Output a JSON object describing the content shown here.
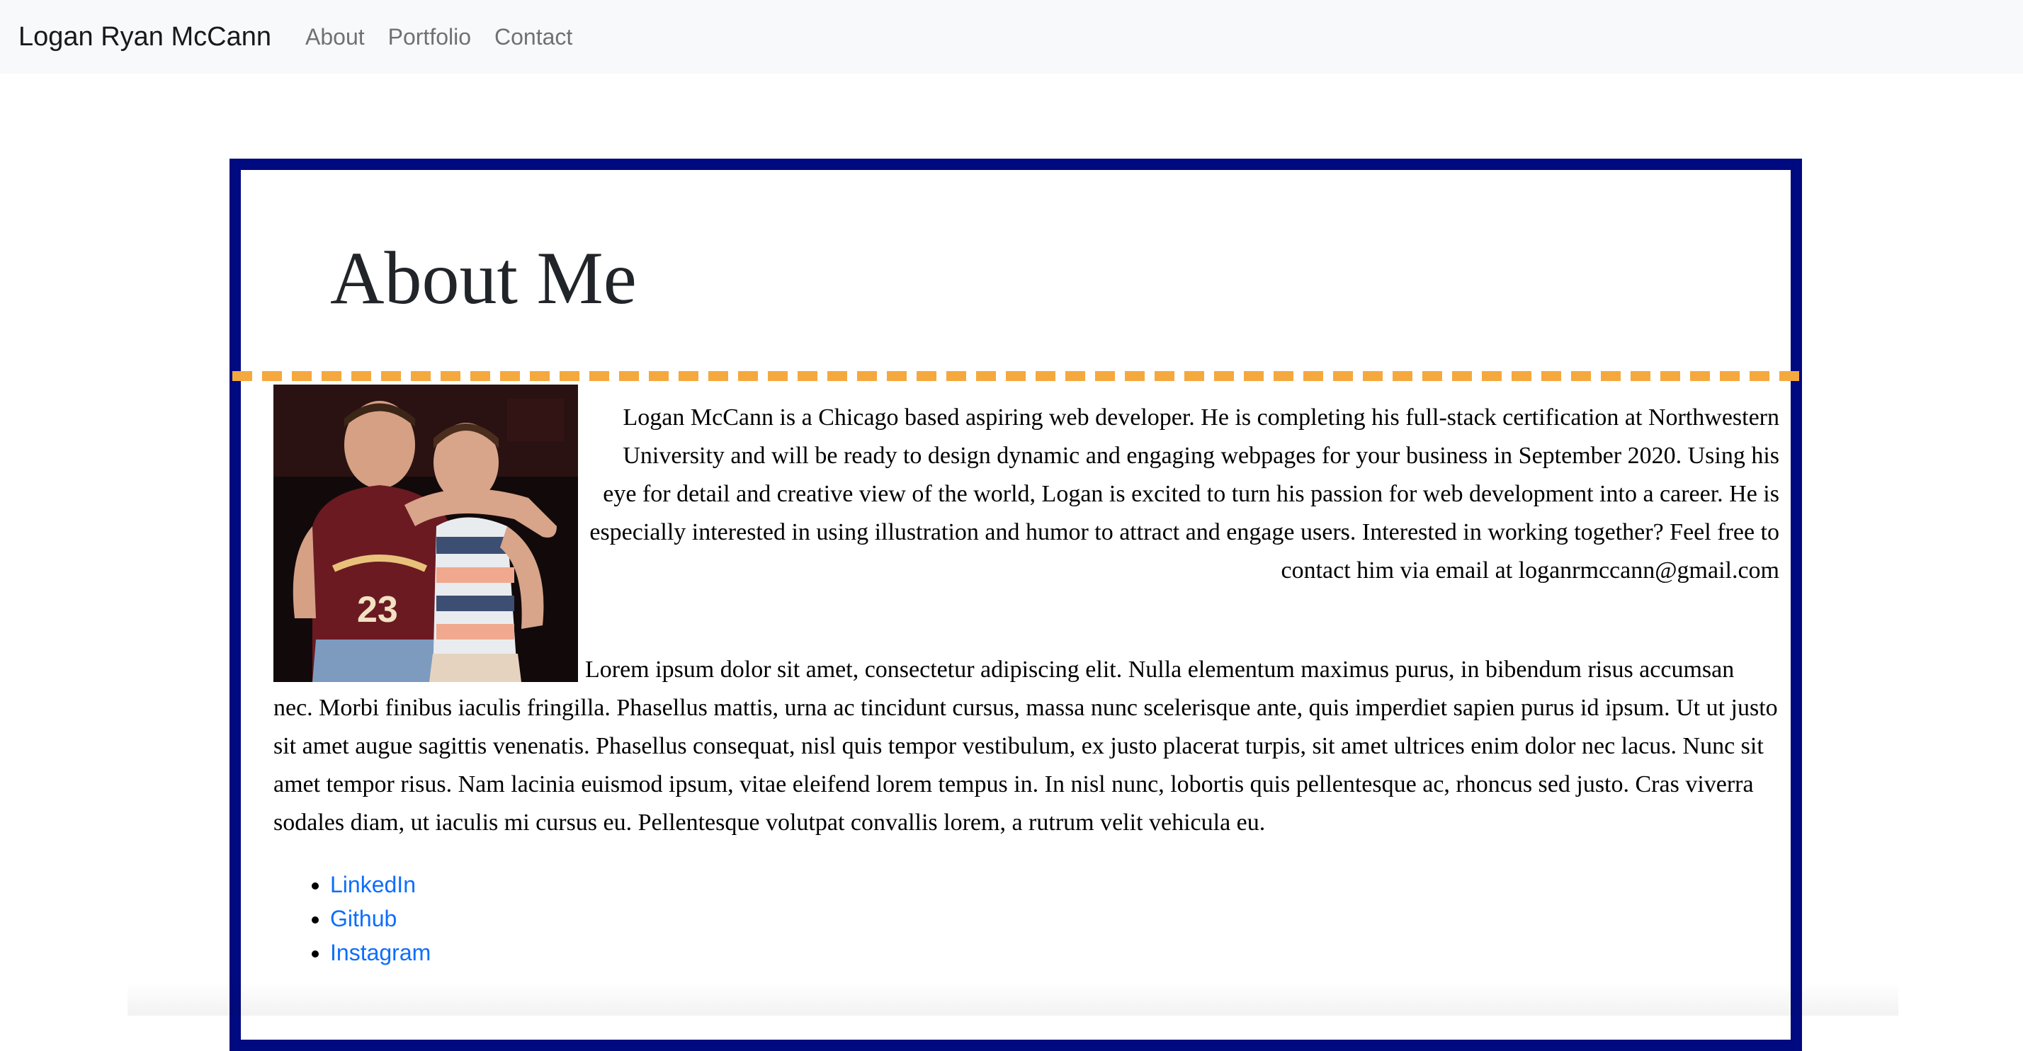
{
  "navbar": {
    "brand": "Logan Ryan McCann",
    "links": [
      {
        "label": "About"
      },
      {
        "label": "Portfolio"
      },
      {
        "label": "Contact"
      }
    ]
  },
  "about": {
    "title": "About Me",
    "photo": {
      "subject": "two young men smiling, one in a maroon Cleveland 23 jersey, one in a striped tank top"
    },
    "intro": "Logan McCann is a Chicago based aspiring web developer. He is completing his full-stack certification at Northwestern University and will be ready to design dynamic and engaging webpages for your business in September 2020. Using his eye for detail and creative view of the world, Logan is excited to turn his passion for web development into a career. He is especially interested in using illustration and humor to attract and engage users. Interested in working together? Feel free to contact him via email at loganrmccann@gmail.com",
    "lorem": "Lorem ipsum dolor sit amet, consectetur adipiscing elit. Nulla elementum maximus purus, in bibendum risus accumsan nec. Morbi finibus iaculis fringilla. Phasellus mattis, urna ac tincidunt cursus, massa nunc scelerisque ante, quis imperdiet sapien purus id ipsum. Ut ut justo sit amet augue sagittis venenatis. Phasellus consequat, nisl quis tempor vestibulum, ex justo placerat turpis, sit amet ultrices enim dolor nec lacus. Nunc sit amet tempor risus. Nam lacinia euismod ipsum, vitae eleifend lorem tempus in. In nisl nunc, lobortis quis pellentesque ac, rhoncus sed justo. Cras viverra sodales diam, ut iaculis mi cursus eu. Pellentesque volutpat convallis lorem, a rutrum velit vehicula eu.",
    "social_links": [
      {
        "label": "LinkedIn"
      },
      {
        "label": "Github"
      },
      {
        "label": "Instagram"
      }
    ]
  },
  "colors": {
    "card_border": "#000a80",
    "divider": "#f5a83d",
    "link": "#0d6efd",
    "navbar_bg": "#f8f9fa"
  }
}
